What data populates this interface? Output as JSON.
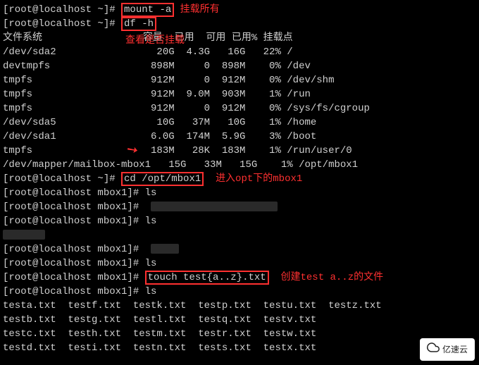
{
  "prompts": {
    "home": "[root@localhost ~]# ",
    "mbox": "[root@localhost mbox1]# "
  },
  "cmds": {
    "mount": "mount -a",
    "df": "df -h",
    "cd": "cd /opt/mbox1",
    "ls": "ls",
    "touch": "touch test{a..z}.txt"
  },
  "annot": {
    "mount_all": "挂载所有",
    "check_mount": "查看是否挂载",
    "enter_mbox": "进入opt下的mbox1",
    "create_files": "创建test a..z的文件"
  },
  "df_header": "文件系统                 容量  已用  可用 已用% 挂载点",
  "df_rows": [
    "/dev/sda2                 20G  4.3G   16G   22% /",
    "devtmpfs                 898M     0  898M    0% /dev",
    "tmpfs                    912M     0  912M    0% /dev/shm",
    "tmpfs                    912M  9.0M  903M    1% /run",
    "tmpfs                    912M     0  912M    0% /sys/fs/cgroup",
    "/dev/sda5                 10G   37M   10G    1% /home",
    "/dev/sda1                6.0G  174M  5.9G    3% /boot",
    "tmpfs                    183M   28K  183M    1% /run/user/0",
    "/dev/mapper/mailbox-mbox1   15G   33M   15G    1% /opt/mbox1"
  ],
  "ls_rows": [
    "testa.txt  testf.txt  testk.txt  testp.txt  testu.txt  testz.txt",
    "testb.txt  testg.txt  testl.txt  testq.txt  testv.txt",
    "testc.txt  testh.txt  testm.txt  testr.txt  testw.txt",
    "testd.txt  testi.txt  testn.txt  tests.txt  testx.txt"
  ],
  "watermark": "亿速云"
}
